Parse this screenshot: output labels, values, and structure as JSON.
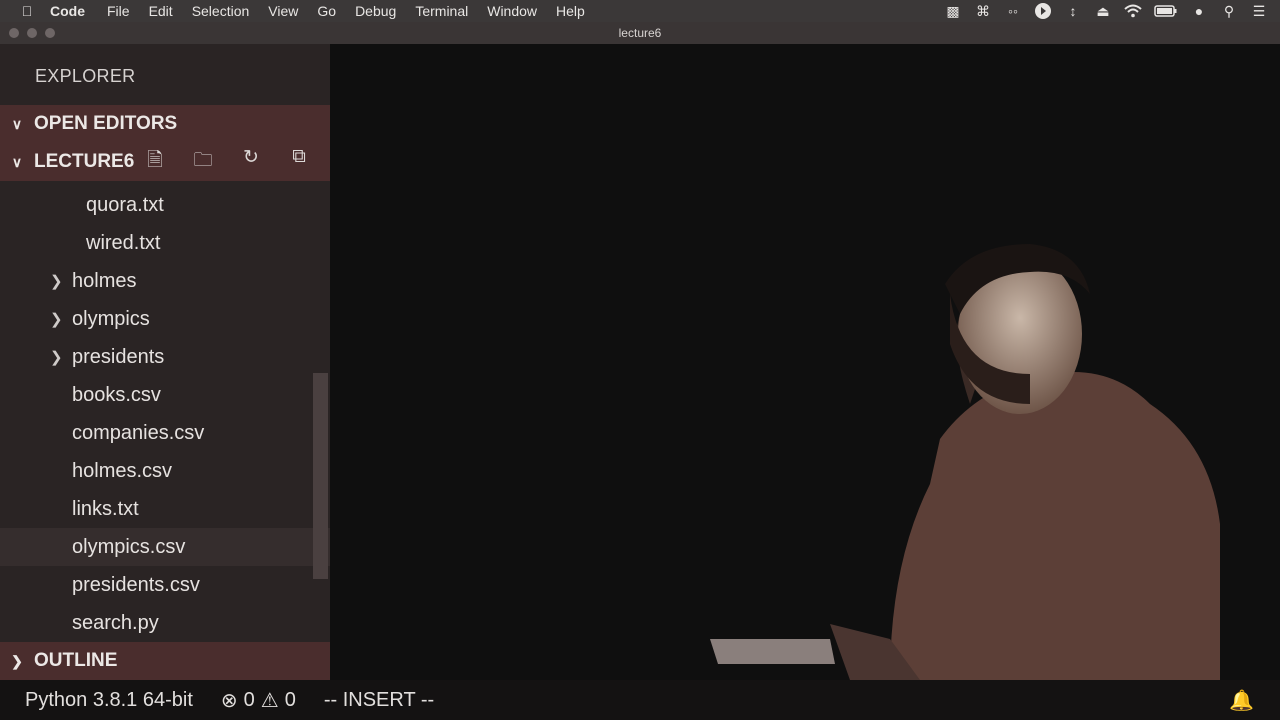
{
  "menubar": {
    "app_name": "Code",
    "items": [
      "File",
      "Edit",
      "Selection",
      "View",
      "Go",
      "Debug",
      "Terminal",
      "Window",
      "Help"
    ],
    "tray_icons": [
      "docker-icon",
      "command-icon",
      "glasses-icon",
      "play-circle-icon",
      "scroll-icon",
      "eject-icon",
      "wifi-icon",
      "battery-icon",
      "user-icon",
      "search-icon",
      "list-icon"
    ]
  },
  "window": {
    "title": "lecture6"
  },
  "sidebar": {
    "title": "EXPLORER",
    "open_editors": "OPEN EDITORS",
    "folder": "LECTURE6",
    "outline": "OUTLINE",
    "items": [
      {
        "label": "quora.txt",
        "type": "file",
        "depth": 2
      },
      {
        "label": "wired.txt",
        "type": "file",
        "depth": 2
      },
      {
        "label": "holmes",
        "type": "folder",
        "depth": 1
      },
      {
        "label": "olympics",
        "type": "folder",
        "depth": 1
      },
      {
        "label": "presidents",
        "type": "folder",
        "depth": 1
      },
      {
        "label": "books.csv",
        "type": "file",
        "depth": 1
      },
      {
        "label": "companies.csv",
        "type": "file",
        "depth": 1
      },
      {
        "label": "holmes.csv",
        "type": "file",
        "depth": 1
      },
      {
        "label": "links.txt",
        "type": "file",
        "depth": 1
      },
      {
        "label": "olympics.csv",
        "type": "file",
        "depth": 1
      },
      {
        "label": "presidents.csv",
        "type": "file",
        "depth": 1
      },
      {
        "label": "search.py",
        "type": "file",
        "depth": 1
      }
    ]
  },
  "statusbar": {
    "python": "Python 3.8.1 64-bit",
    "errors": "0",
    "warnings": "0",
    "mode": "-- INSERT --"
  }
}
